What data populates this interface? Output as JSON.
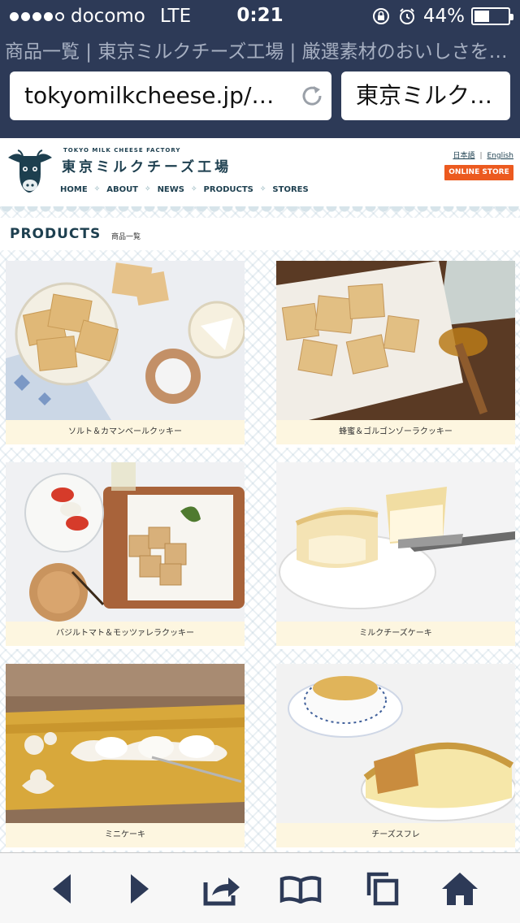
{
  "status_bar": {
    "carrier": "docomo",
    "network": "LTE",
    "time": "0:21",
    "battery": "44%",
    "battery_level": 0.44
  },
  "browser": {
    "page_title": "商品一覧 | 東京ミルクチーズ工場 | 厳選素材のおいしさを…",
    "url": "tokyomilkcheese.jp/pr…",
    "tab_title": "東京ミルク…"
  },
  "site": {
    "brand_small": "TOKYO MILK CHEESE FACTORY",
    "brand_jp": "東京ミルクチーズ工場",
    "nav": [
      "HOME",
      "ABOUT",
      "NEWS",
      "PRODUCTS",
      "STORES"
    ],
    "lang_ja": "日本語",
    "lang_sep": "|",
    "lang_en": "English",
    "online_store": "ONLINE STORE"
  },
  "products": {
    "title": "PRODUCTS",
    "subtitle": "商品一覧",
    "items": [
      {
        "name": "ソルト＆カマンベールクッキー"
      },
      {
        "name": "蜂蜜＆ゴルゴンゾーラクッキー"
      },
      {
        "name": "バジルトマト＆モッツァレラクッキー"
      },
      {
        "name": "ミルクチーズケーキ"
      },
      {
        "name": "ミニケーキ"
      },
      {
        "name": "チーズスフレ"
      }
    ]
  },
  "colors": {
    "ios_bar": "#2d3a57",
    "brand_navy": "#1d3f4f",
    "online_store_orange": "#ec5a1f",
    "caption_bg": "#fdf6e0",
    "toolbar_icon": "#2d3a57"
  },
  "icons": {
    "toolbar": [
      "back-icon",
      "forward-icon",
      "share-icon",
      "bookmarks-icon",
      "tabs-icon",
      "home-icon"
    ]
  }
}
